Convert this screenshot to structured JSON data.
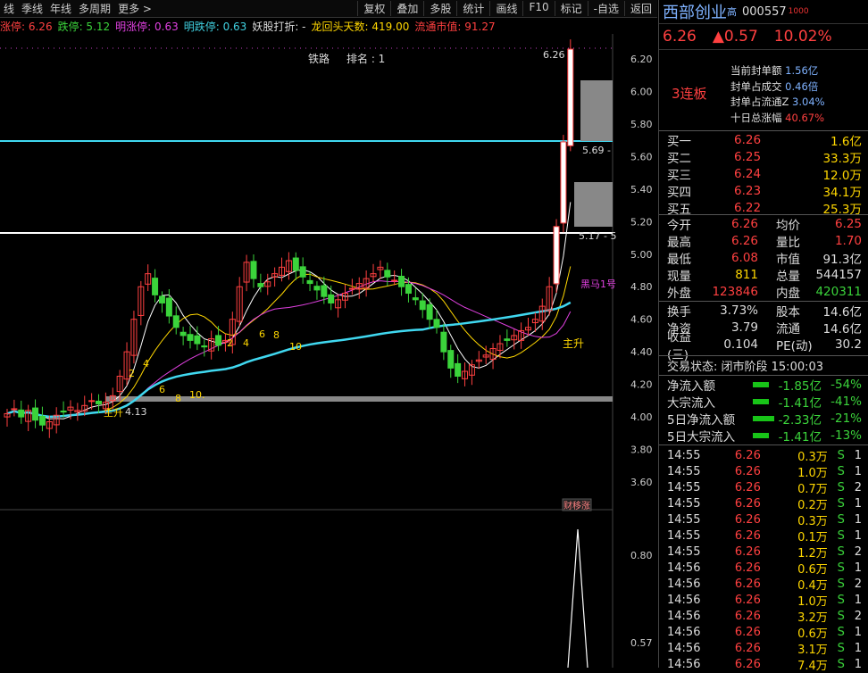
{
  "toolbar": {
    "left": [
      "线",
      "季线",
      "年线",
      "多周期",
      "更多 >"
    ],
    "right": [
      "复权",
      "叠加",
      "多股",
      "统计",
      "画线",
      "F10",
      "标记",
      "-自选",
      "返回"
    ]
  },
  "infobar": {
    "zhangting": "涨停: 6.26",
    "dieting": "跌停: 5.12",
    "mingzhang": "明涨停: 0.63",
    "mingdie": "明跌停: 0.63",
    "yaogu": "妖股打折: -",
    "longhui": "龙回头天数: 419.00",
    "liutong": "流通市值: 91.27"
  },
  "chart": {
    "sector": "铁路",
    "rank": "排名 : 1",
    "price_ticks": [
      "6.20",
      "6.00",
      "5.80",
      "5.60",
      "5.40",
      "5.20",
      "5.00",
      "4.80",
      "4.60",
      "4.40",
      "4.20",
      "4.00",
      "3.80",
      "3.60"
    ],
    "lower_ticks": [
      "0.80",
      "0.57"
    ],
    "label_high": "6.26",
    "label_569": "5.69 -",
    "label_517": "5.17 - 5",
    "label_413": "4.13",
    "label_zhusheng1": "主升",
    "label_zhusheng2": "主升",
    "label_heima": "黑马1号",
    "seq_labels": [
      "2",
      "4",
      "6",
      "8",
      "10.",
      "2",
      "4",
      "6",
      "8",
      "10"
    ],
    "label_caixiao": "财移涨"
  },
  "quote": {
    "name": "西部创业",
    "gao": "高",
    "code": "000557",
    "tag": "1000",
    "price": "6.26",
    "change": "▲0.57",
    "pct": "10.02%",
    "lianban": "3连板",
    "feng": [
      {
        "label": "当前封单额",
        "value": "1.56亿"
      },
      {
        "label": "封单占成交",
        "value": "0.46倍"
      },
      {
        "label": "封单占流通Z",
        "value": "3.04%"
      },
      {
        "label": "十日总涨幅",
        "value": "40.67%"
      }
    ]
  },
  "bids": [
    {
      "label": "买一",
      "price": "6.26",
      "vol": "1.6亿"
    },
    {
      "label": "买二",
      "price": "6.25",
      "vol": "33.3万"
    },
    {
      "label": "买三",
      "price": "6.24",
      "vol": "12.0万"
    },
    {
      "label": "买四",
      "price": "6.23",
      "vol": "34.1万"
    },
    {
      "label": "买五",
      "price": "6.22",
      "vol": "25.3万"
    }
  ],
  "stats": [
    {
      "l1": "今开",
      "v1": "6.26",
      "l2": "均价",
      "v2": "6.25"
    },
    {
      "l1": "最高",
      "v1": "6.26",
      "l2": "量比",
      "v2": "1.70"
    },
    {
      "l1": "最低",
      "v1": "6.08",
      "l2": "市值",
      "v2": "91.3亿"
    },
    {
      "l1": "现量",
      "v1": "811",
      "l2": "总量",
      "v2": "544157"
    },
    {
      "l1": "外盘",
      "v1": "123846",
      "l2": "内盘",
      "v2": "420311"
    }
  ],
  "stats2": [
    {
      "l1": "换手",
      "v1": "3.73%",
      "l2": "股本",
      "v2": "14.6亿"
    },
    {
      "l1": "净资",
      "v1": "3.79",
      "l2": "流通",
      "v2": "14.6亿"
    },
    {
      "l1": "收益(三)",
      "v1": "0.104",
      "l2": "PE(动)",
      "v2": "30.2"
    }
  ],
  "trade_status": "交易状态: 闭市阶段 15:00:03",
  "flows": [
    {
      "label": "净流入额",
      "value": "-1.85亿",
      "pct": "-54%"
    },
    {
      "label": "大宗流入",
      "value": "-1.41亿",
      "pct": "-41%"
    },
    {
      "label": "5日净流入额",
      "value": "-2.33亿",
      "pct": "-21%"
    },
    {
      "label": "5日大宗流入",
      "value": "-1.41亿",
      "pct": "-13%"
    }
  ],
  "ticks": [
    {
      "t": "14:55",
      "p": "6.26",
      "q": "0.3万",
      "s": "S",
      "n": "1"
    },
    {
      "t": "14:55",
      "p": "6.26",
      "q": "1.0万",
      "s": "S",
      "n": "1"
    },
    {
      "t": "14:55",
      "p": "6.26",
      "q": "0.7万",
      "s": "S",
      "n": "2"
    },
    {
      "t": "14:55",
      "p": "6.26",
      "q": "0.2万",
      "s": "S",
      "n": "1"
    },
    {
      "t": "14:55",
      "p": "6.26",
      "q": "0.3万",
      "s": "S",
      "n": "1"
    },
    {
      "t": "14:55",
      "p": "6.26",
      "q": "0.1万",
      "s": "S",
      "n": "1"
    },
    {
      "t": "14:55",
      "p": "6.26",
      "q": "1.2万",
      "s": "S",
      "n": "2"
    },
    {
      "t": "14:56",
      "p": "6.26",
      "q": "0.6万",
      "s": "S",
      "n": "1"
    },
    {
      "t": "14:56",
      "p": "6.26",
      "q": "0.4万",
      "s": "S",
      "n": "2"
    },
    {
      "t": "14:56",
      "p": "6.26",
      "q": "1.0万",
      "s": "S",
      "n": "1"
    },
    {
      "t": "14:56",
      "p": "6.26",
      "q": "3.2万",
      "s": "S",
      "n": "2"
    },
    {
      "t": "14:56",
      "p": "6.26",
      "q": "0.6万",
      "s": "S",
      "n": "1"
    },
    {
      "t": "14:56",
      "p": "6.26",
      "q": "3.1万",
      "s": "S",
      "n": "1"
    },
    {
      "t": "14:56",
      "p": "6.26",
      "q": "7.4万",
      "s": "S",
      "n": "1"
    }
  ],
  "colors": {
    "up": "#ff4040",
    "down": "#3bd43b",
    "blue": "#7fb2ff",
    "yellow": "#ffd700"
  }
}
